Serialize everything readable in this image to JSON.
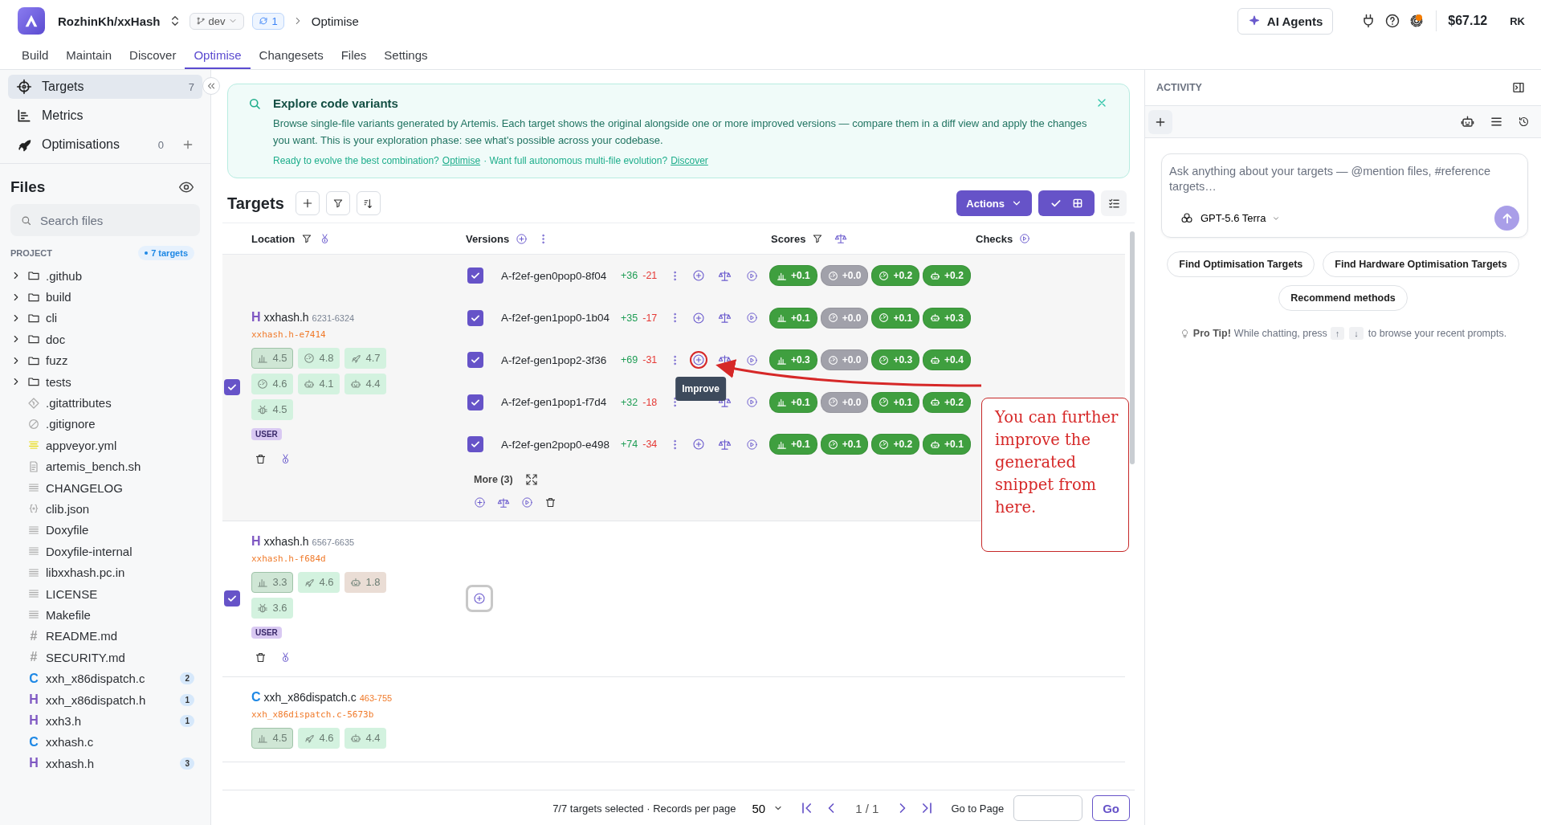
{
  "header": {
    "project": "RozhinKh/xxHash",
    "branch": "dev",
    "sync_count": "1",
    "breadcrumb": "Optimise",
    "ai_button": "AI Agents",
    "notification": true,
    "balance": "$67.12",
    "user": "RK"
  },
  "nav_tabs": [
    {
      "label": "Build",
      "selected": false
    },
    {
      "label": "Maintain",
      "selected": false
    },
    {
      "label": "Discover",
      "selected": false
    },
    {
      "label": "Optimise",
      "selected": true
    },
    {
      "label": "Changesets",
      "selected": false
    },
    {
      "label": "Files",
      "selected": false
    },
    {
      "label": "Settings",
      "selected": false
    }
  ],
  "sidebar": {
    "items": [
      {
        "kind": "targets",
        "label": "Targets",
        "count": "7",
        "selected": true
      },
      {
        "kind": "metrics",
        "label": "Metrics",
        "selected": false
      },
      {
        "kind": "optimisations",
        "label": "Optimisations",
        "count": "0",
        "selected": false
      }
    ],
    "files_title": "Files",
    "search_placeholder": "Search files",
    "section": "PROJECT",
    "targets_badge": "7 targets",
    "files": [
      {
        "kind": "folder",
        "name": ".github"
      },
      {
        "kind": "folder",
        "name": "build"
      },
      {
        "kind": "folder",
        "name": "cli"
      },
      {
        "kind": "folder",
        "name": "doc"
      },
      {
        "kind": "folder",
        "name": "fuzz"
      },
      {
        "kind": "folder",
        "name": "tests"
      },
      {
        "kind": "git",
        "name": ".gitattributes"
      },
      {
        "kind": "ignore",
        "name": ".gitignore"
      },
      {
        "kind": "yaml",
        "name": "appveyor.yml"
      },
      {
        "kind": "script",
        "name": "artemis_bench.sh"
      },
      {
        "kind": "text",
        "name": "CHANGELOG"
      },
      {
        "kind": "json",
        "name": "clib.json"
      },
      {
        "kind": "text",
        "name": "Doxyfile"
      },
      {
        "kind": "text",
        "name": "Doxyfile-internal"
      },
      {
        "kind": "text",
        "name": "libxxhash.pc.in"
      },
      {
        "kind": "text",
        "name": "LICENSE"
      },
      {
        "kind": "text",
        "name": "Makefile"
      },
      {
        "kind": "hash",
        "glyph": "#",
        "name": "README.md"
      },
      {
        "kind": "hash",
        "glyph": "#",
        "name": "SECURITY.md"
      },
      {
        "kind": "c",
        "glyph": "C",
        "name": "xxh_x86dispatch.c",
        "count": "2"
      },
      {
        "kind": "h",
        "glyph": "H",
        "name": "xxh_x86dispatch.h",
        "count": "1"
      },
      {
        "kind": "h",
        "glyph": "H",
        "name": "xxh3.h",
        "count": "1"
      },
      {
        "kind": "c",
        "glyph": "C",
        "name": "xxhash.c"
      },
      {
        "kind": "h",
        "glyph": "H",
        "name": "xxhash.h",
        "count": "3"
      }
    ]
  },
  "banner": {
    "title": "Explore code variants",
    "body": "Browse single-file variants generated by Artemis. Each target shows the original alongside one or more improved versions — compare them in a diff view and apply the changes you want. This is your exploration phase: see what's possible across your codebase.",
    "prompt_1": "Ready to evolve the best combination?",
    "link_1": "Optimise",
    "prompt_2": "· Want full autonomous multi-file evolution?",
    "link_2": "Discover"
  },
  "targets_panel": {
    "title": "Targets",
    "actions": "Actions",
    "select_mode": true,
    "columns": [
      "Location",
      "Versions",
      "Scores",
      "Checks"
    ],
    "targets": [
      {
        "kind": "h",
        "glyph": "H",
        "name": "xxhash.h",
        "lines": "6231-6324",
        "lines_highlight": false,
        "variant": "xxhash.h-e7414",
        "checked": true,
        "tag": "USER",
        "metrics": [
          {
            "kind": "bars",
            "value": "4.5",
            "color": "#cfe6d5"
          },
          {
            "kind": "gauge",
            "value": "4.8",
            "color": "#d3f2df"
          },
          {
            "kind": "rocket",
            "value": "4.7",
            "color": "#d3f2df"
          },
          {
            "kind": "gauge",
            "value": "4.6",
            "color": "#d3f2df"
          },
          {
            "kind": "robot",
            "value": "4.1",
            "color": "#d3f2df"
          },
          {
            "kind": "robot",
            "value": "4.4",
            "color": "#d3f2df"
          },
          {
            "kind": "bug",
            "value": "4.5",
            "color": "#d3f2df"
          }
        ],
        "versions": [
          {
            "name": "A-f2ef-gen0pop0-8f04",
            "added": "+36",
            "removed": "-21",
            "checked": true,
            "highlighted": false,
            "scores": [
              {
                "kind": "bars",
                "value": "+0.1",
                "color": "#3f9f3f"
              },
              {
                "kind": "gauge",
                "value": "+0.0",
                "color": "#a1a1aa"
              },
              {
                "kind": "gauge",
                "value": "+0.2",
                "color": "#3f9f3f"
              },
              {
                "kind": "robot",
                "value": "+0.2",
                "color": "#3f9f3f"
              }
            ]
          },
          {
            "name": "A-f2ef-gen1pop0-1b04",
            "added": "+35",
            "removed": "-17",
            "checked": true,
            "highlighted": false,
            "scores": [
              {
                "kind": "bars",
                "value": "+0.1",
                "color": "#3f9f3f"
              },
              {
                "kind": "gauge",
                "value": "+0.0",
                "color": "#a1a1aa"
              },
              {
                "kind": "gauge",
                "value": "+0.1",
                "color": "#3f9f3f"
              },
              {
                "kind": "robot",
                "value": "+0.3",
                "color": "#3f9f3f"
              }
            ]
          },
          {
            "name": "A-f2ef-gen1pop2-3f36",
            "added": "+69",
            "removed": "-31",
            "checked": true,
            "highlighted": true,
            "tooltip": "Improve",
            "scores": [
              {
                "kind": "bars",
                "value": "+0.3",
                "color": "#3f9f3f"
              },
              {
                "kind": "gauge",
                "value": "+0.0",
                "color": "#a1a1aa"
              },
              {
                "kind": "gauge",
                "value": "+0.3",
                "color": "#3f9f3f"
              },
              {
                "kind": "robot",
                "value": "+0.4",
                "color": "#3f9f3f"
              }
            ]
          },
          {
            "name": "A-f2ef-gen1pop1-f7d4",
            "added": "+32",
            "removed": "-18",
            "checked": true,
            "scores": [
              {
                "kind": "bars",
                "value": "+0.1",
                "color": "#3f9f3f"
              },
              {
                "kind": "gauge",
                "value": "+0.0",
                "color": "#a1a1aa"
              },
              {
                "kind": "gauge",
                "value": "+0.1",
                "color": "#3f9f3f"
              },
              {
                "kind": "robot",
                "value": "+0.2",
                "color": "#3f9f3f"
              }
            ]
          },
          {
            "name": "A-f2ef-gen2pop0-e498",
            "added": "+74",
            "removed": "-34",
            "checked": true,
            "highlighted": false,
            "scores": [
              {
                "kind": "bars",
                "value": "+0.1",
                "color": "#3f9f3f"
              },
              {
                "kind": "gauge",
                "value": "+0.1",
                "color": "#3f9f3f"
              },
              {
                "kind": "gauge",
                "value": "+0.2",
                "color": "#3f9f3f"
              },
              {
                "kind": "robot",
                "value": "+0.1",
                "color": "#3f9f3f"
              }
            ]
          }
        ],
        "more": "More (3)"
      },
      {
        "kind": "h",
        "glyph": "H",
        "name": "xxhash.h",
        "lines": "6567-6635",
        "lines_highlight": false,
        "variant": "xxhash.h-f684d",
        "checked": true,
        "tag": "USER",
        "metrics": [
          {
            "kind": "bars",
            "value": "3.3",
            "color": "#cfe6d5"
          },
          {
            "kind": "rocket",
            "value": "4.6",
            "color": "#d3f2df"
          },
          {
            "kind": "robot",
            "value": "1.8",
            "color": "#eaddd5"
          },
          {
            "kind": "bug",
            "value": "3.6",
            "color": "#d3f2df"
          }
        ]
      },
      {
        "kind": "c",
        "glyph": "C",
        "name": "xxh_x86dispatch.c",
        "lines": "463-755",
        "lines_highlight": true,
        "variant": "xxh_x86dispatch.c-5673b",
        "metrics": [
          {
            "kind": "bars",
            "value": "4.5",
            "color": "#cfe6d5"
          },
          {
            "kind": "rocket",
            "value": "4.6",
            "color": "#d3f2df"
          },
          {
            "kind": "robot",
            "value": "4.4",
            "color": "#d3f2df"
          }
        ]
      }
    ],
    "footer": {
      "selection": "7/7 targets selected · Records per page",
      "per_page": "50",
      "page": "1 / 1",
      "goto": "Go to Page",
      "go": "Go"
    }
  },
  "annotation": {
    "text": "You can further improve the generated snippet from here."
  },
  "activity": {
    "title": "ACTIVITY",
    "placeholder": "Ask anything about your targets — @mention files, #reference targets…",
    "model": "GPT-5.6 Terra",
    "suggestions": [
      "Find Optimisation Targets",
      "Find Hardware Optimisation Targets",
      "Recommend methods"
    ],
    "tip_label": "Pro Tip!",
    "tip_text": "While chatting, press",
    "keys": [
      "↑",
      "↓"
    ],
    "tip_end": "to browse your recent prompts."
  }
}
